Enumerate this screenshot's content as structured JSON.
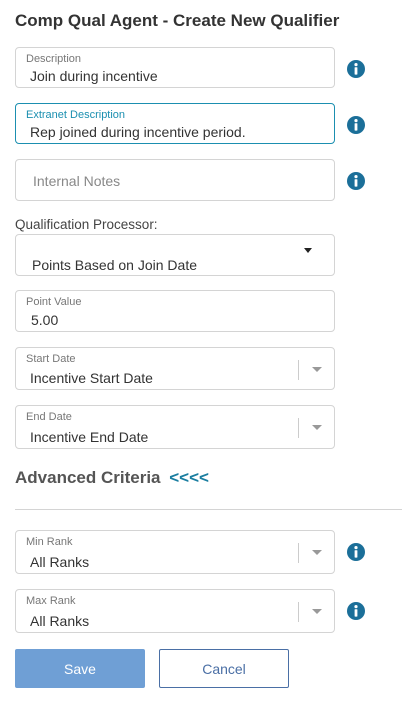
{
  "page_title": "Comp Qual Agent - Create New Qualifier",
  "fields": {
    "description": {
      "label": "Description",
      "value": "Join during incentive"
    },
    "extranet_description": {
      "label": "Extranet Description",
      "value": "Rep joined during incentive period."
    },
    "internal_notes": {
      "placeholder": "Internal Notes"
    },
    "qualification_processor": {
      "label": "Qualification Processor:",
      "selected": "Points Based on Join Date"
    },
    "point_value": {
      "label": "Point Value",
      "value": "5.00"
    },
    "start_date": {
      "label": "Start Date",
      "selected": "Incentive Start Date"
    },
    "end_date": {
      "label": "End Date",
      "selected": "Incentive End Date"
    }
  },
  "advanced": {
    "title": "Advanced Criteria",
    "toggle": "<<<<",
    "min_rank": {
      "label": "Min Rank",
      "selected": "All Ranks"
    },
    "max_rank": {
      "label": "Max Rank",
      "selected": "All Ranks"
    }
  },
  "buttons": {
    "save": "Save",
    "cancel": "Cancel"
  },
  "icons": {
    "info": "info-circle-icon"
  },
  "colors": {
    "accent": "#1b8fb0",
    "info_icon": "#1b6f99",
    "save_button": "#6f9fd5",
    "cancel_border": "#4a6fa5",
    "advanced_toggle": "#1b7ea0"
  }
}
